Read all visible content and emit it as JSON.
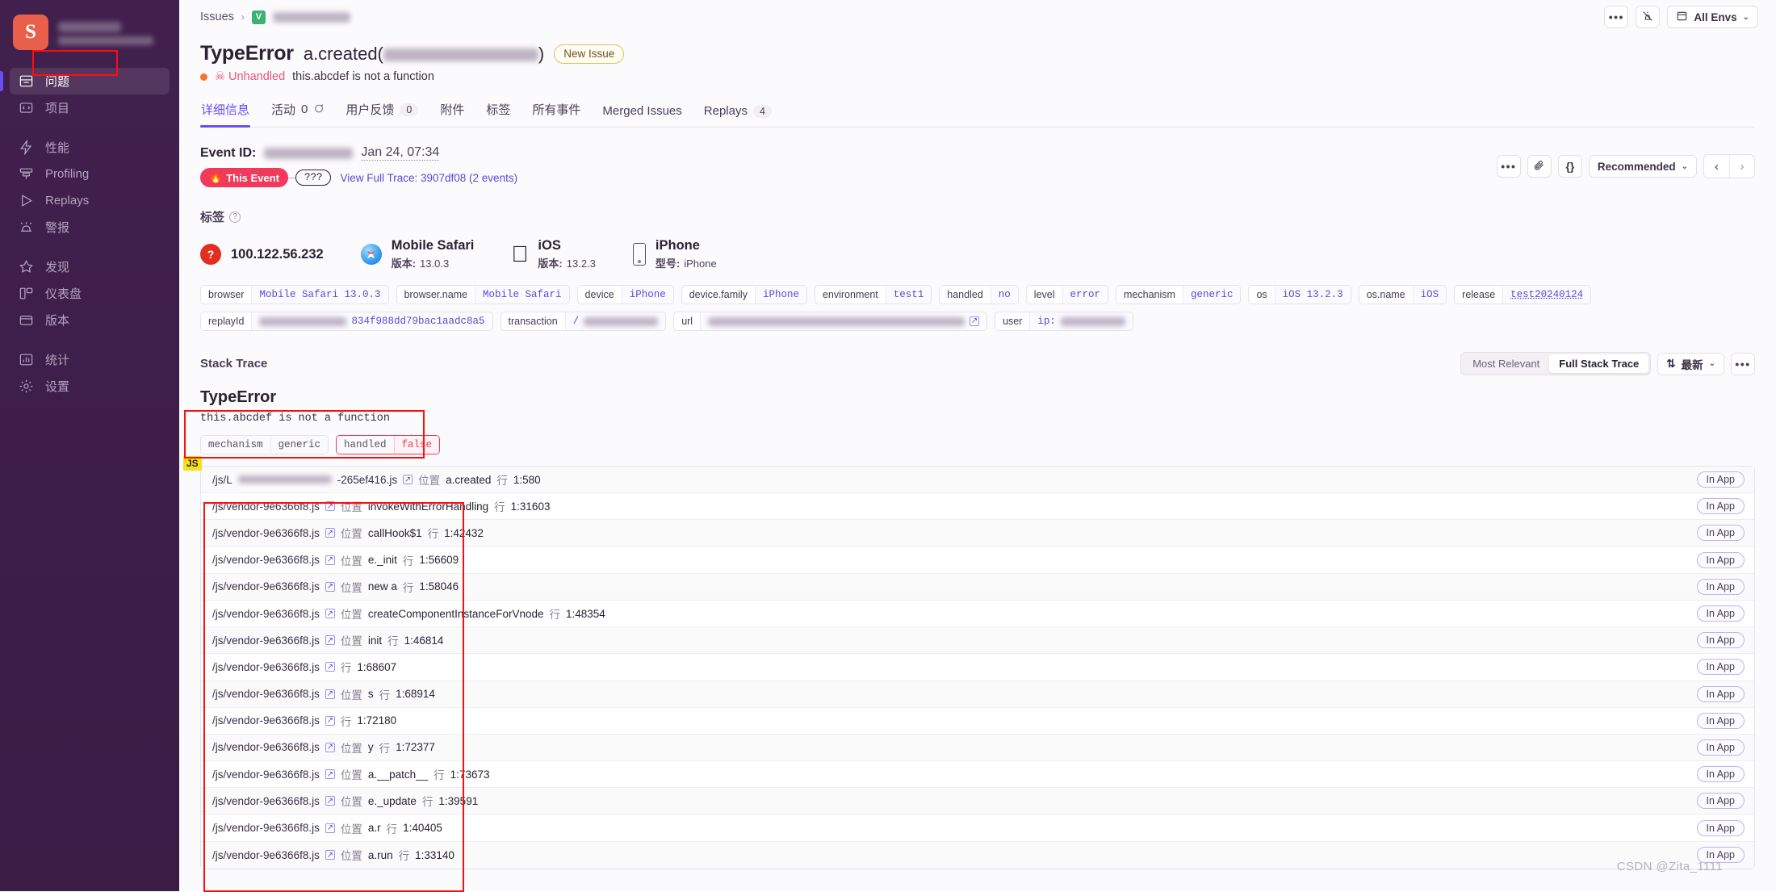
{
  "sidebar": {
    "org_logo_letter": "S",
    "items": [
      {
        "label": "问题",
        "icon": "issues-icon",
        "active": true
      },
      {
        "label": "项目",
        "icon": "projects-icon",
        "active": false
      },
      {
        "label": "性能",
        "icon": "performance-icon",
        "active": false
      },
      {
        "label": "Profiling",
        "icon": "profiling-icon",
        "active": false
      },
      {
        "label": "Replays",
        "icon": "replays-icon",
        "active": false
      },
      {
        "label": "警报",
        "icon": "alerts-icon",
        "active": false
      },
      {
        "label": "发现",
        "icon": "discover-icon",
        "active": false
      },
      {
        "label": "仪表盘",
        "icon": "dashboards-icon",
        "active": false
      },
      {
        "label": "版本",
        "icon": "releases-icon",
        "active": false
      },
      {
        "label": "统计",
        "icon": "stats-icon",
        "active": false
      },
      {
        "label": "设置",
        "icon": "settings-icon",
        "active": false
      }
    ]
  },
  "topbar": {
    "breadcrumb_root": "Issues",
    "breadcrumb_sep": "›",
    "project_badge": "V",
    "more_label": "•••",
    "mute_icon": "mute-bell-icon",
    "env_label": "All Envs",
    "env_chevron": "⌄"
  },
  "issue": {
    "error_type": "TypeError",
    "function": "a.created(",
    "function_close": ")",
    "badge": "New Issue",
    "level_icon": "level-dot",
    "handled_label": "Unhandled",
    "skull_icon": "☠",
    "culprit": "this.abcdef is not a function"
  },
  "tabs": [
    {
      "label": "详细信息",
      "count": null,
      "active": true
    },
    {
      "label": "活动",
      "count": "0",
      "bubble": true,
      "active": false
    },
    {
      "label": "用户反馈",
      "count": "0",
      "active": false
    },
    {
      "label": "附件",
      "count": null,
      "active": false
    },
    {
      "label": "标签",
      "count": null,
      "active": false
    },
    {
      "label": "所有事件",
      "count": null,
      "active": false
    },
    {
      "label": "Merged Issues",
      "count": null,
      "active": false
    },
    {
      "label": "Replays",
      "count": "4",
      "active": false
    }
  ],
  "event": {
    "id_label": "Event ID:",
    "date": "Jan 24, 07:34",
    "this_event": "This Event",
    "fire_icon": "🔥",
    "unknown_chip": "???",
    "trace_link": "View Full Trace: 3907df08 (2 events)",
    "controls": {
      "more": "•••",
      "attachment_icon": "paperclip-icon",
      "json_icon": "{}",
      "sort_label": "Recommended",
      "prev": "‹",
      "next": "›"
    }
  },
  "tags_section": {
    "title": "标签",
    "help_icon": "?",
    "cards": [
      {
        "icon": "ip-icon",
        "main": "100.122.56.232",
        "sub_key": "",
        "sub_val": ""
      },
      {
        "icon": "safari-icon",
        "main": "Mobile Safari",
        "sub_key": "版本:",
        "sub_val": "13.0.3"
      },
      {
        "icon": "apple-icon",
        "main": "iOS",
        "sub_key": "版本:",
        "sub_val": "13.2.3"
      },
      {
        "icon": "iphone-icon",
        "main": "iPhone",
        "sub_key": "型号:",
        "sub_val": "iPhone"
      }
    ],
    "pills": [
      {
        "key": "browser",
        "value": "Mobile Safari 13.0.3"
      },
      {
        "key": "browser.name",
        "value": "Mobile Safari"
      },
      {
        "key": "device",
        "value": "iPhone"
      },
      {
        "key": "device.family",
        "value": "iPhone"
      },
      {
        "key": "environment",
        "value": "test1"
      },
      {
        "key": "handled",
        "value": "no"
      },
      {
        "key": "level",
        "value": "error"
      },
      {
        "key": "mechanism",
        "value": "generic"
      },
      {
        "key": "os",
        "value": "iOS 13.2.3"
      },
      {
        "key": "os.name",
        "value": "iOS"
      },
      {
        "key": "release",
        "value": "test20240124",
        "underline": true
      }
    ],
    "pills_row2": [
      {
        "key": "replayId",
        "value": "834f988dd79bac1aadc8a5",
        "redacted_before": 120
      },
      {
        "key": "transaction",
        "value": "/",
        "redacted_after": 96
      },
      {
        "key": "url",
        "value": "",
        "redacted_after": 330,
        "ext_icon": true
      },
      {
        "key": "user",
        "value": "ip:",
        "redacted_after": 82
      }
    ]
  },
  "stack_trace": {
    "title": "Stack Trace",
    "toggle": {
      "left": "Most Relevant",
      "right": "Full Stack Trace",
      "selected": "right"
    },
    "sort": {
      "icon": "⇅",
      "label": "最新",
      "chevron": "⌄"
    },
    "more": "•••",
    "error_title": "TypeError",
    "error_message": "this.abcdef is not a function",
    "mech_pills": [
      {
        "key": "mechanism",
        "value": "generic",
        "danger": false
      },
      {
        "key": "handled",
        "value": "false",
        "danger": true
      }
    ],
    "platform_badge": "JS",
    "loc_word": "位置",
    "line_word": "行",
    "in_app_label": "In App",
    "frames": [
      {
        "file": "/js/L",
        "redacted": true,
        "file_tail": "-265ef416.js",
        "fn": "a.created",
        "line": "1:580",
        "in_app": true
      },
      {
        "file": "/js/vendor-9e6366f8.js",
        "fn": "invokeWithErrorHandling",
        "line": "1:31603",
        "in_app": true
      },
      {
        "file": "/js/vendor-9e6366f8.js",
        "fn": "callHook$1",
        "line": "1:42432",
        "in_app": true
      },
      {
        "file": "/js/vendor-9e6366f8.js",
        "fn": "e._init",
        "line": "1:56609",
        "in_app": true
      },
      {
        "file": "/js/vendor-9e6366f8.js",
        "fn": "new a",
        "line": "1:58046",
        "in_app": true
      },
      {
        "file": "/js/vendor-9e6366f8.js",
        "fn": "createComponentInstanceForVnode",
        "line": "1:48354",
        "in_app": true
      },
      {
        "file": "/js/vendor-9e6366f8.js",
        "fn": "init",
        "line": "1:46814",
        "in_app": true
      },
      {
        "file": "/js/vendor-9e6366f8.js",
        "fn": "",
        "line": "1:68607",
        "in_app": true
      },
      {
        "file": "/js/vendor-9e6366f8.js",
        "fn": "s",
        "line": "1:68914",
        "in_app": true
      },
      {
        "file": "/js/vendor-9e6366f8.js",
        "fn": "",
        "line": "1:72180",
        "in_app": true
      },
      {
        "file": "/js/vendor-9e6366f8.js",
        "fn": "y",
        "line": "1:72377",
        "in_app": true
      },
      {
        "file": "/js/vendor-9e6366f8.js",
        "fn": "a.__patch__",
        "line": "1:73673",
        "in_app": true
      },
      {
        "file": "/js/vendor-9e6366f8.js",
        "fn": "e._update",
        "line": "1:39591",
        "in_app": true
      },
      {
        "file": "/js/vendor-9e6366f8.js",
        "fn": "a.r",
        "line": "1:40405",
        "in_app": true
      },
      {
        "file": "/js/vendor-9e6366f8.js",
        "fn": "a.run",
        "line": "1:33140",
        "in_app": true
      }
    ]
  },
  "watermark": "CSDN @Zita_1111",
  "colors": {
    "accent": "#6b4df0",
    "link": "#5b49d6",
    "danger": "#f1395b",
    "sidebar": "#3b1d47",
    "annotation": "#ff0d0d",
    "brand": "#e8604c"
  }
}
